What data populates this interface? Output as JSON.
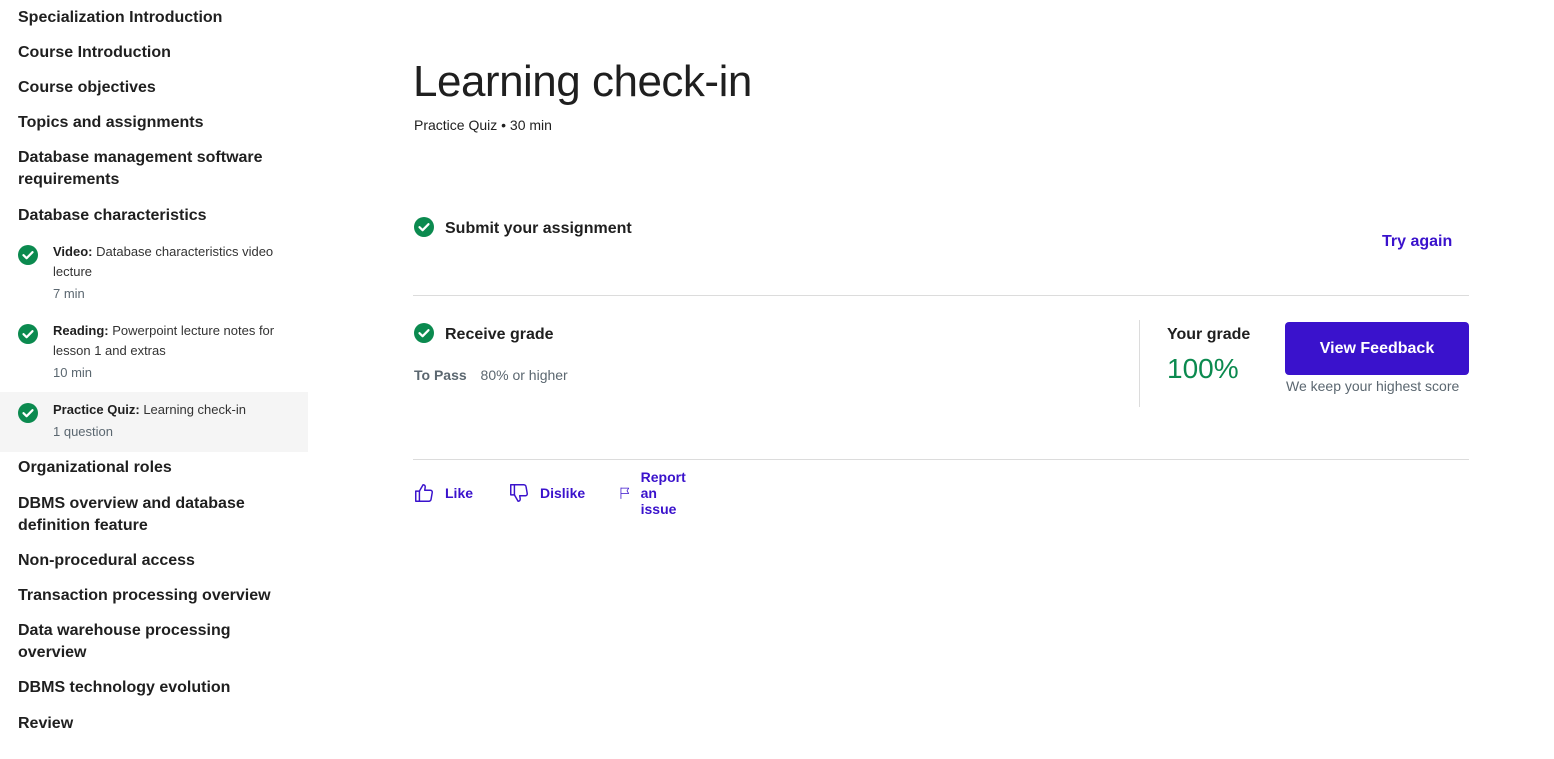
{
  "sidebar": {
    "headings": [
      "Specialization Introduction",
      "Course Introduction",
      "Course objectives",
      "Topics and assignments",
      "Database management software requirements",
      "Database characteristics"
    ],
    "items": [
      {
        "type": "Video:",
        "title": "Database characteristics video lecture",
        "sub": "7 min"
      },
      {
        "type": "Reading:",
        "title": "Powerpoint lecture notes for lesson 1 and extras",
        "sub": "10 min"
      },
      {
        "type": "Practice Quiz:",
        "title": "Learning check-in",
        "sub": "1 question"
      }
    ],
    "after_headings": [
      "Organizational roles",
      "DBMS overview and database definition feature",
      "Non-procedural access",
      "Transaction processing overview",
      "Data warehouse processing overview",
      "DBMS technology evolution",
      "Review"
    ]
  },
  "main": {
    "title": "Learning check-in",
    "meta": "Practice Quiz • 30 min",
    "submit": {
      "title": "Submit your assignment",
      "try_again": "Try again"
    },
    "receive": {
      "title": "Receive grade",
      "to_pass_label": "To Pass",
      "to_pass_value": "80% or higher",
      "grade_label": "Your grade",
      "grade_value": "100%",
      "view_feedback": "View Feedback",
      "keep_note": "We keep your highest score"
    },
    "actions": {
      "like": "Like",
      "dislike": "Dislike",
      "report": "Report an issue"
    }
  },
  "colors": {
    "accent": "#3a12cc",
    "success": "#0b8a4f"
  }
}
